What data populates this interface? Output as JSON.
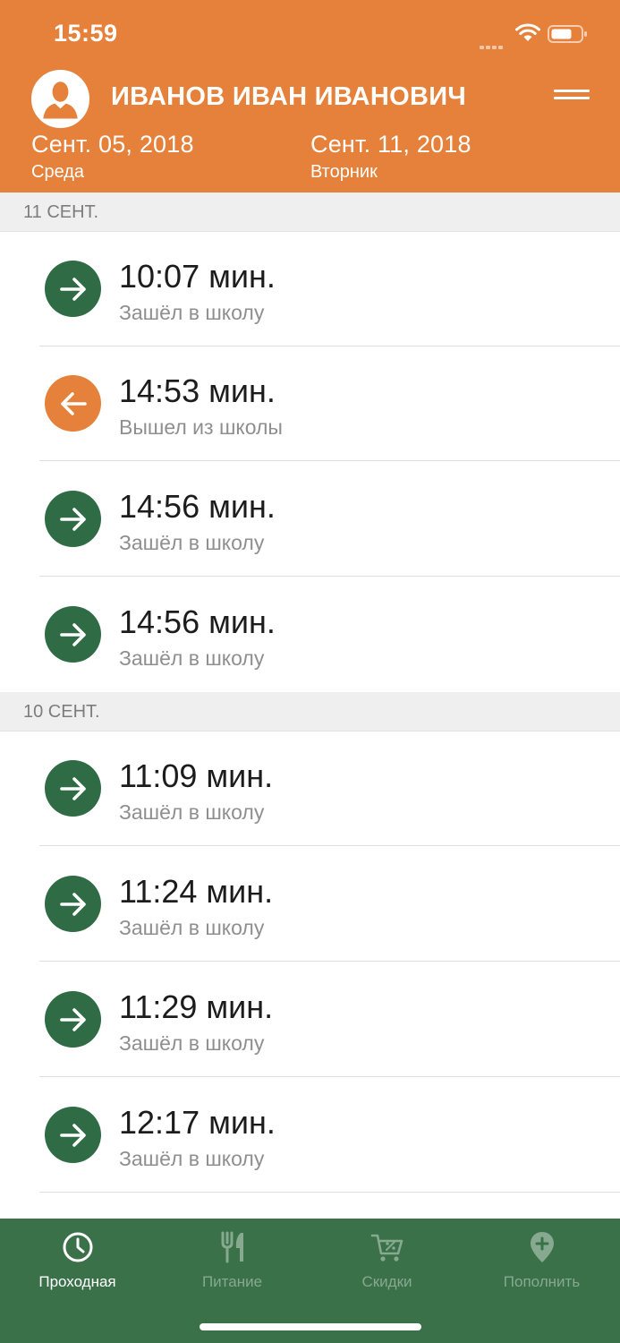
{
  "status_bar": {
    "time": "15:59"
  },
  "header": {
    "user_name": "ИВАНОВ ИВАН ИВАНОВИЧ",
    "date_start": {
      "date": "Сент. 05, 2018",
      "weekday": "Среда"
    },
    "date_end": {
      "date": "Сент. 11, 2018",
      "weekday": "Вторник"
    }
  },
  "colors": {
    "header": "#e5813a",
    "enter": "#2f6b44",
    "exit": "#e5813a",
    "tabbar": "#3a7149"
  },
  "sections": [
    {
      "title": "11 СЕНТ.",
      "rows": [
        {
          "time": "10:07 мин.",
          "label": "Зашёл в школу",
          "direction": "enter",
          "icon": "arrow-right-icon"
        },
        {
          "time": "14:53 мин.",
          "label": "Вышел из школы",
          "direction": "exit",
          "icon": "arrow-left-icon"
        },
        {
          "time": "14:56 мин.",
          "label": "Зашёл в школу",
          "direction": "enter",
          "icon": "arrow-right-icon"
        },
        {
          "time": "14:56 мин.",
          "label": "Зашёл в школу",
          "direction": "enter",
          "icon": "arrow-right-icon"
        }
      ]
    },
    {
      "title": "10 СЕНТ.",
      "rows": [
        {
          "time": "11:09 мин.",
          "label": "Зашёл в школу",
          "direction": "enter",
          "icon": "arrow-right-icon"
        },
        {
          "time": "11:24 мин.",
          "label": "Зашёл в школу",
          "direction": "enter",
          "icon": "arrow-right-icon"
        },
        {
          "time": "11:29 мин.",
          "label": "Зашёл в школу",
          "direction": "enter",
          "icon": "arrow-right-icon"
        },
        {
          "time": "12:17 мин.",
          "label": "Зашёл в школу",
          "direction": "enter",
          "icon": "arrow-right-icon"
        }
      ]
    }
  ],
  "tabbar": {
    "tabs": [
      {
        "label": "Проходная",
        "icon": "clock-icon",
        "active": true
      },
      {
        "label": "Питание",
        "icon": "fork-knife-icon",
        "active": false
      },
      {
        "label": "Скидки",
        "icon": "discount-cart-icon",
        "active": false
      },
      {
        "label": "Пополнить",
        "icon": "location-plus-icon",
        "active": false
      }
    ]
  }
}
